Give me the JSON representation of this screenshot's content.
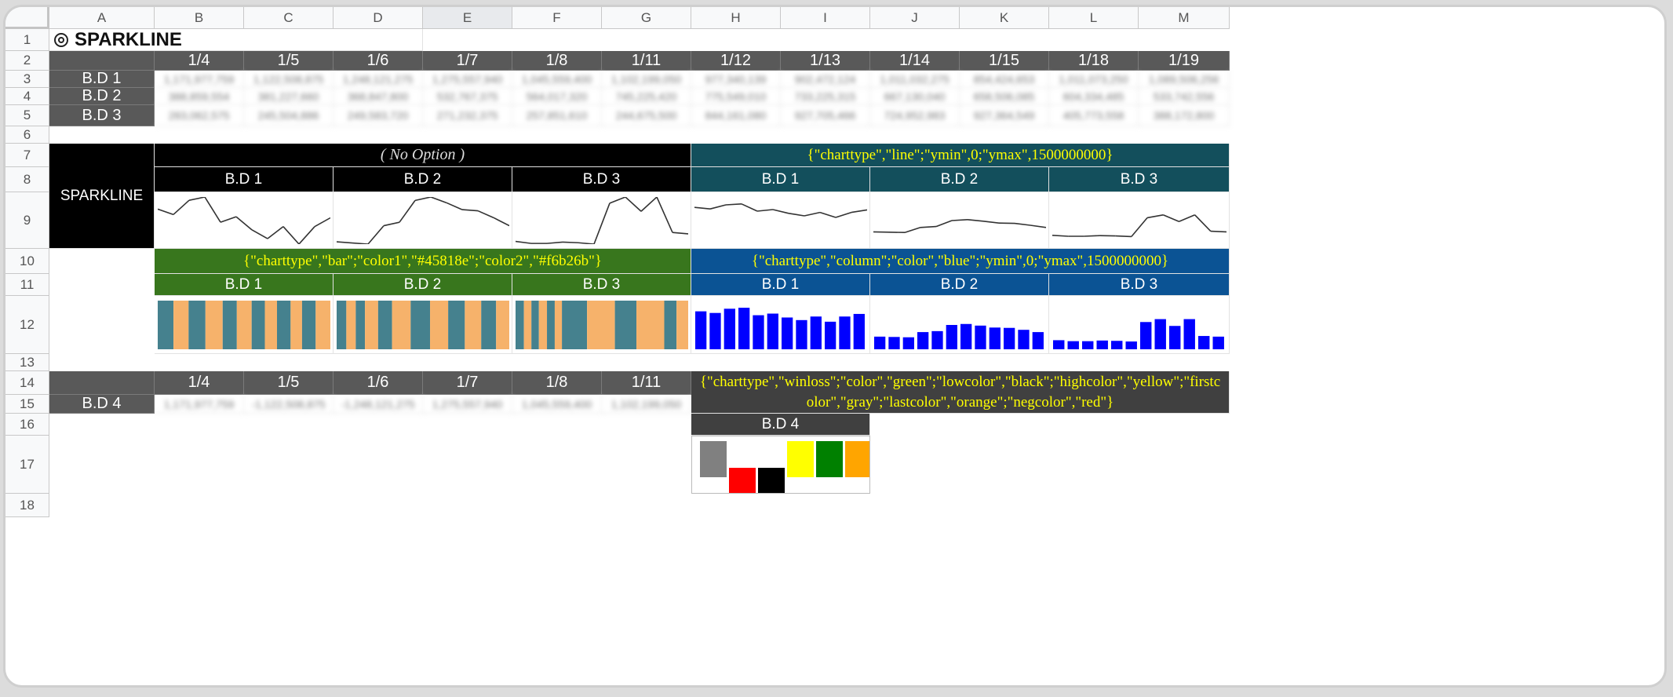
{
  "sheet": {
    "columns": [
      "A",
      "B",
      "C",
      "D",
      "E",
      "F",
      "G",
      "H",
      "I",
      "J",
      "K",
      "L",
      "M"
    ],
    "rows": [
      "1",
      "2",
      "3",
      "4",
      "5",
      "6",
      "7",
      "8",
      "9",
      "10",
      "11",
      "12",
      "13",
      "14",
      "15",
      "16",
      "17",
      "18"
    ],
    "title": "SPARKLINE",
    "dates_top": [
      "1/4",
      "1/5",
      "1/6",
      "1/7",
      "1/8",
      "1/11",
      "1/12",
      "1/13",
      "1/14",
      "1/15",
      "1/18",
      "1/19"
    ],
    "series": [
      {
        "label": "B.D 1",
        "values": [
          "1,171,977,759",
          "1,122,508,875",
          "1,248,121,275",
          "1,275,557,940",
          "1,045,559,400",
          "1,102,199,050",
          "977,340,139",
          "902,472,124",
          "1,011,032,275",
          "854,424,653",
          "1,011,073,250",
          "1,089,506,256"
        ]
      },
      {
        "label": "B.D 2",
        "values": [
          "388,859,554",
          "381,227,660",
          "368,847,800",
          "532,767,375",
          "564,017,320",
          "745,225,420",
          "775,549,010",
          "733,225,315",
          "667,130,040",
          "658,506,085",
          "604,334,485",
          "533,742,556"
        ]
      },
      {
        "label": "B.D 3",
        "values": [
          "283,062,575",
          "245,504,886",
          "249,583,720",
          "271,232,375",
          "257,851,610",
          "244,675,500",
          "844,161,080",
          "927,705,466",
          "724,952,983",
          "927,364,549",
          "405,773,558",
          "388,172,800"
        ]
      }
    ],
    "sparkline_label": "SPARKLINE",
    "no_option": "( No Option )",
    "line_option": "{\"charttype\",\"line\";\"ymin\",0;\"ymax\",1500000000}",
    "bar_option": "{\"charttype\",\"bar\";\"color1\",\"#45818e\";\"color2\",\"#f6b26b\"}",
    "column_option": "{\"charttype\",\"column\";\"color\",\"blue\";\"ymin\",0;\"ymax\",1500000000}",
    "winloss_option": "{\"charttype\",\"winloss\";\"color\",\"green\";\"lowcolor\",\"black\";\"highcolor\",\"yellow\";\"firstcolor\",\"gray\";\"lastcolor\",\"orange\";\"negcolor\",\"red\"}",
    "bd_labels": [
      "B.D 1",
      "B.D 2",
      "B.D 3"
    ],
    "dates_bottom": [
      "1/4",
      "1/5",
      "1/6",
      "1/7",
      "1/8",
      "1/11"
    ],
    "bd4": {
      "label": "B.D 4",
      "values": [
        "1,171,977,759",
        "-1,122,508,875",
        "-1,248,121,275",
        "1,275,557,940",
        "1,045,559,400",
        "1,102,199,050"
      ]
    },
    "winloss_title": "B.D 4"
  },
  "colors": {
    "dark_header": "#595959",
    "black": "#000000",
    "teal": "#134f5c",
    "green": "#38761d",
    "blue": "#0b5394",
    "bar1": "#45818e",
    "bar2": "#f6b26b",
    "column": "#0000ff",
    "option_text": "#ffff00"
  },
  "chart_data": [
    {
      "type": "line",
      "title": "B.D 1",
      "values": [
        1.17,
        1.12,
        1.25,
        1.28,
        1.05,
        1.1,
        0.98,
        0.9,
        1.01,
        0.85,
        1.01,
        1.09
      ],
      "unit": "billion",
      "ylim": "auto"
    },
    {
      "type": "line",
      "title": "B.D 2",
      "values": [
        0.39,
        0.38,
        0.37,
        0.53,
        0.56,
        0.75,
        0.78,
        0.73,
        0.67,
        0.66,
        0.6,
        0.53
      ],
      "unit": "billion",
      "ylim": "auto"
    },
    {
      "type": "line",
      "title": "B.D 3",
      "values": [
        0.28,
        0.25,
        0.25,
        0.27,
        0.26,
        0.24,
        0.84,
        0.93,
        0.72,
        0.93,
        0.41,
        0.39
      ],
      "unit": "billion",
      "ylim": "auto"
    },
    {
      "type": "line",
      "title": "B.D 1",
      "values": [
        1.17,
        1.12,
        1.25,
        1.28,
        1.05,
        1.1,
        0.98,
        0.9,
        1.01,
        0.85,
        1.01,
        1.09
      ],
      "ylim": [
        0,
        1.5
      ]
    },
    {
      "type": "line",
      "title": "B.D 2",
      "values": [
        0.39,
        0.38,
        0.37,
        0.53,
        0.56,
        0.75,
        0.78,
        0.73,
        0.67,
        0.66,
        0.6,
        0.53
      ],
      "ylim": [
        0,
        1.5
      ]
    },
    {
      "type": "line",
      "title": "B.D 3",
      "values": [
        0.28,
        0.25,
        0.25,
        0.27,
        0.26,
        0.24,
        0.84,
        0.93,
        0.72,
        0.93,
        0.41,
        0.39
      ],
      "ylim": [
        0,
        1.5
      ]
    },
    {
      "type": "bar",
      "title": "B.D 1",
      "values": [
        1.17,
        1.12,
        1.25,
        1.28,
        1.05,
        1.1,
        0.98,
        0.9,
        1.01,
        0.85,
        1.01,
        1.09
      ]
    },
    {
      "type": "bar",
      "title": "B.D 2",
      "values": [
        0.39,
        0.38,
        0.37,
        0.53,
        0.56,
        0.75,
        0.78,
        0.73,
        0.67,
        0.66,
        0.6,
        0.53
      ]
    },
    {
      "type": "bar",
      "title": "B.D 3",
      "values": [
        0.28,
        0.25,
        0.25,
        0.27,
        0.26,
        0.24,
        0.84,
        0.93,
        0.72,
        0.93,
        0.41,
        0.39
      ]
    },
    {
      "type": "bar",
      "title": "B.D 1",
      "values": [
        1.17,
        1.12,
        1.25,
        1.28,
        1.05,
        1.1,
        0.98,
        0.9,
        1.01,
        0.85,
        1.01,
        1.09
      ],
      "ylim": [
        0,
        1.5
      ]
    },
    {
      "type": "bar",
      "title": "B.D 2",
      "values": [
        0.39,
        0.38,
        0.37,
        0.53,
        0.56,
        0.75,
        0.78,
        0.73,
        0.67,
        0.66,
        0.6,
        0.53
      ],
      "ylim": [
        0,
        1.5
      ]
    },
    {
      "type": "bar",
      "title": "B.D 3",
      "values": [
        0.28,
        0.25,
        0.25,
        0.27,
        0.26,
        0.24,
        0.84,
        0.93,
        0.72,
        0.93,
        0.41,
        0.39
      ],
      "ylim": [
        0,
        1.5
      ]
    },
    {
      "type": "bar",
      "title": "B.D 4",
      "values": [
        1,
        -1,
        -1,
        1,
        1,
        1
      ]
    }
  ]
}
